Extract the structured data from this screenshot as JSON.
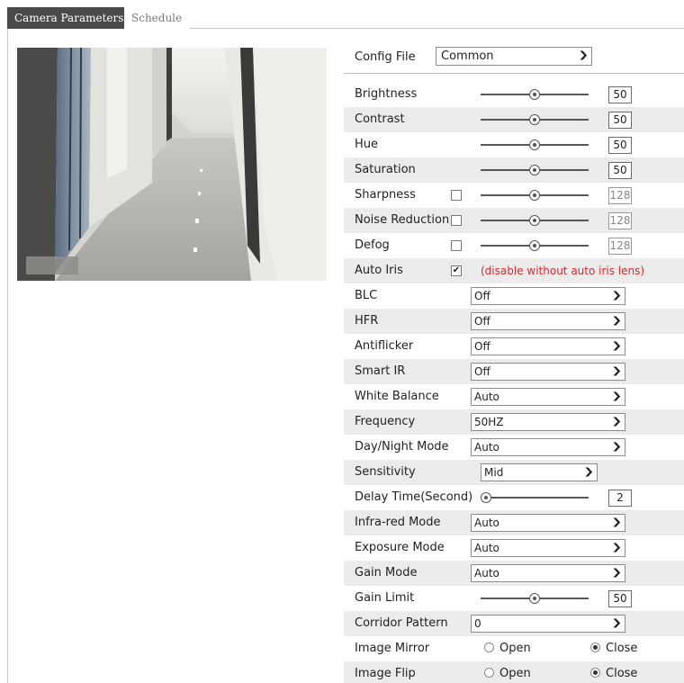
{
  "tabs": {
    "active": "Camera Parameters",
    "inactive": "Schedule"
  },
  "config": {
    "label": "Config File",
    "value": "Common"
  },
  "sliders": {
    "brightness": {
      "label": "Brightness",
      "value": "50",
      "level": 0.5
    },
    "contrast": {
      "label": "Contrast",
      "value": "50",
      "level": 0.5
    },
    "hue": {
      "label": "Hue",
      "value": "50",
      "level": 0.5
    },
    "saturation": {
      "label": "Saturation",
      "value": "50",
      "level": 0.5
    },
    "sharpness": {
      "label": "Sharpness",
      "value": "128",
      "level": 0.5,
      "checked": false
    },
    "noise_reduction": {
      "label": "Noise Reduction",
      "value": "128",
      "level": 0.5,
      "checked": false
    },
    "defog": {
      "label": "Defog",
      "value": "128",
      "level": 0.5,
      "checked": false
    },
    "delay_time": {
      "label": "Delay Time(Second)",
      "value": "2",
      "level": 0.0
    },
    "gain_limit": {
      "label": "Gain Limit",
      "value": "50",
      "level": 0.5
    }
  },
  "auto_iris": {
    "label": "Auto Iris",
    "checked": true,
    "note": "(disable without auto iris lens)"
  },
  "selects": {
    "blc": {
      "label": "BLC",
      "value": "Off"
    },
    "hfr": {
      "label": "HFR",
      "value": "Off"
    },
    "antiflicker": {
      "label": "Antiflicker",
      "value": "Off"
    },
    "smart_ir": {
      "label": "Smart IR",
      "value": "Off"
    },
    "white_balance": {
      "label": "White Balance",
      "value": "Auto"
    },
    "frequency": {
      "label": "Frequency",
      "value": "50HZ"
    },
    "day_night": {
      "label": "Day/Night Mode",
      "value": "Auto"
    },
    "sensitivity": {
      "label": "Sensitivity",
      "value": "Mid"
    },
    "infrared": {
      "label": "Infra-red Mode",
      "value": "Auto"
    },
    "exposure": {
      "label": "Exposure Mode",
      "value": "Auto"
    },
    "gain_mode": {
      "label": "Gain Mode",
      "value": "Auto"
    },
    "corridor": {
      "label": "Corridor Pattern",
      "value": "0"
    }
  },
  "image_mirror": {
    "label": "Image Mirror",
    "open": "Open",
    "close": "Close",
    "selected": "close"
  },
  "image_flip": {
    "label": "Image Flip",
    "open": "Open",
    "close": "Close",
    "selected": "close"
  },
  "icons": {
    "dropdown": "chevron-down-icon",
    "checkbox": "check-icon",
    "radio": "radio-icon"
  },
  "colors": {
    "tab_active_bg": "#4a4a4a",
    "row_shade": "#ebebeb",
    "warning": "#d42a2a"
  }
}
